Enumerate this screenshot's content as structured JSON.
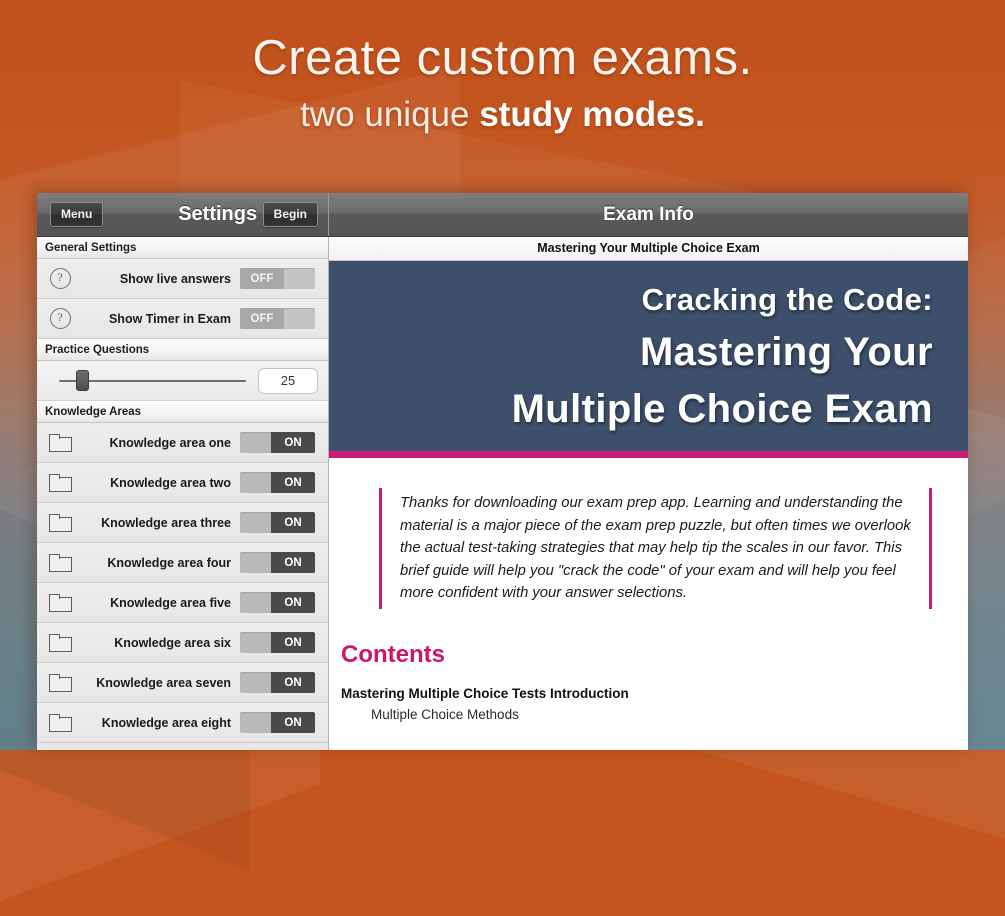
{
  "marketing": {
    "headline_line1": "Create custom exams.",
    "headline_line2_prefix": "two unique ",
    "headline_line2_bold": "study modes."
  },
  "colors": {
    "accent_magenta": "#cc1a78",
    "hero_background": "#3d4f6b",
    "background_top": "#c1511c",
    "background_bottom": "#5f7f8b"
  },
  "app": {
    "toolbar": {
      "menu_label": "Menu",
      "settings_title": "Settings",
      "begin_label": "Begin",
      "exam_info_title": "Exam Info"
    },
    "sidebar": {
      "general_settings_header": "General Settings",
      "general_settings": [
        {
          "icon": "question-mark-icon",
          "label": "Show live answers",
          "toggle": "OFF"
        },
        {
          "icon": "question-mark-icon",
          "label": "Show Timer in Exam",
          "toggle": "OFF"
        }
      ],
      "practice_questions_header": "Practice Questions",
      "practice_questions_value": "25",
      "knowledge_areas_header": "Knowledge Areas",
      "knowledge_areas": [
        {
          "icon": "folder-icon",
          "label": "Knowledge area one",
          "toggle": "ON"
        },
        {
          "icon": "folder-icon",
          "label": "Knowledge area two",
          "toggle": "ON"
        },
        {
          "icon": "folder-icon",
          "label": "Knowledge area three",
          "toggle": "ON"
        },
        {
          "icon": "folder-icon",
          "label": "Knowledge area four",
          "toggle": "ON"
        },
        {
          "icon": "folder-icon",
          "label": "Knowledge area five",
          "toggle": "ON"
        },
        {
          "icon": "folder-icon",
          "label": "Knowledge area six",
          "toggle": "ON"
        },
        {
          "icon": "folder-icon",
          "label": "Knowledge area seven",
          "toggle": "ON"
        },
        {
          "icon": "folder-icon",
          "label": "Knowledge area eight",
          "toggle": "ON"
        }
      ]
    },
    "content": {
      "doc_subtitle": "Mastering Your Multiple Choice Exam",
      "hero_subtitle": "Cracking the Code:",
      "hero_title_line1": "Mastering Your",
      "hero_title_line2": "Multiple Choice Exam",
      "intro_paragraph": "Thanks for downloading our exam prep app. Learning and understanding the material is a major piece of the exam prep puzzle, but often times we overlook the actual test-taking strategies that may help tip the scales in our favor. This brief guide will help you \"crack the code\" of your exam and will help you feel more confident with your answer selections.",
      "contents_heading": "Contents",
      "toc": [
        {
          "level": "heading",
          "text": "Mastering Multiple Choice Tests Introduction"
        },
        {
          "level": "sub",
          "text": "Multiple Choice Methods"
        }
      ]
    }
  }
}
